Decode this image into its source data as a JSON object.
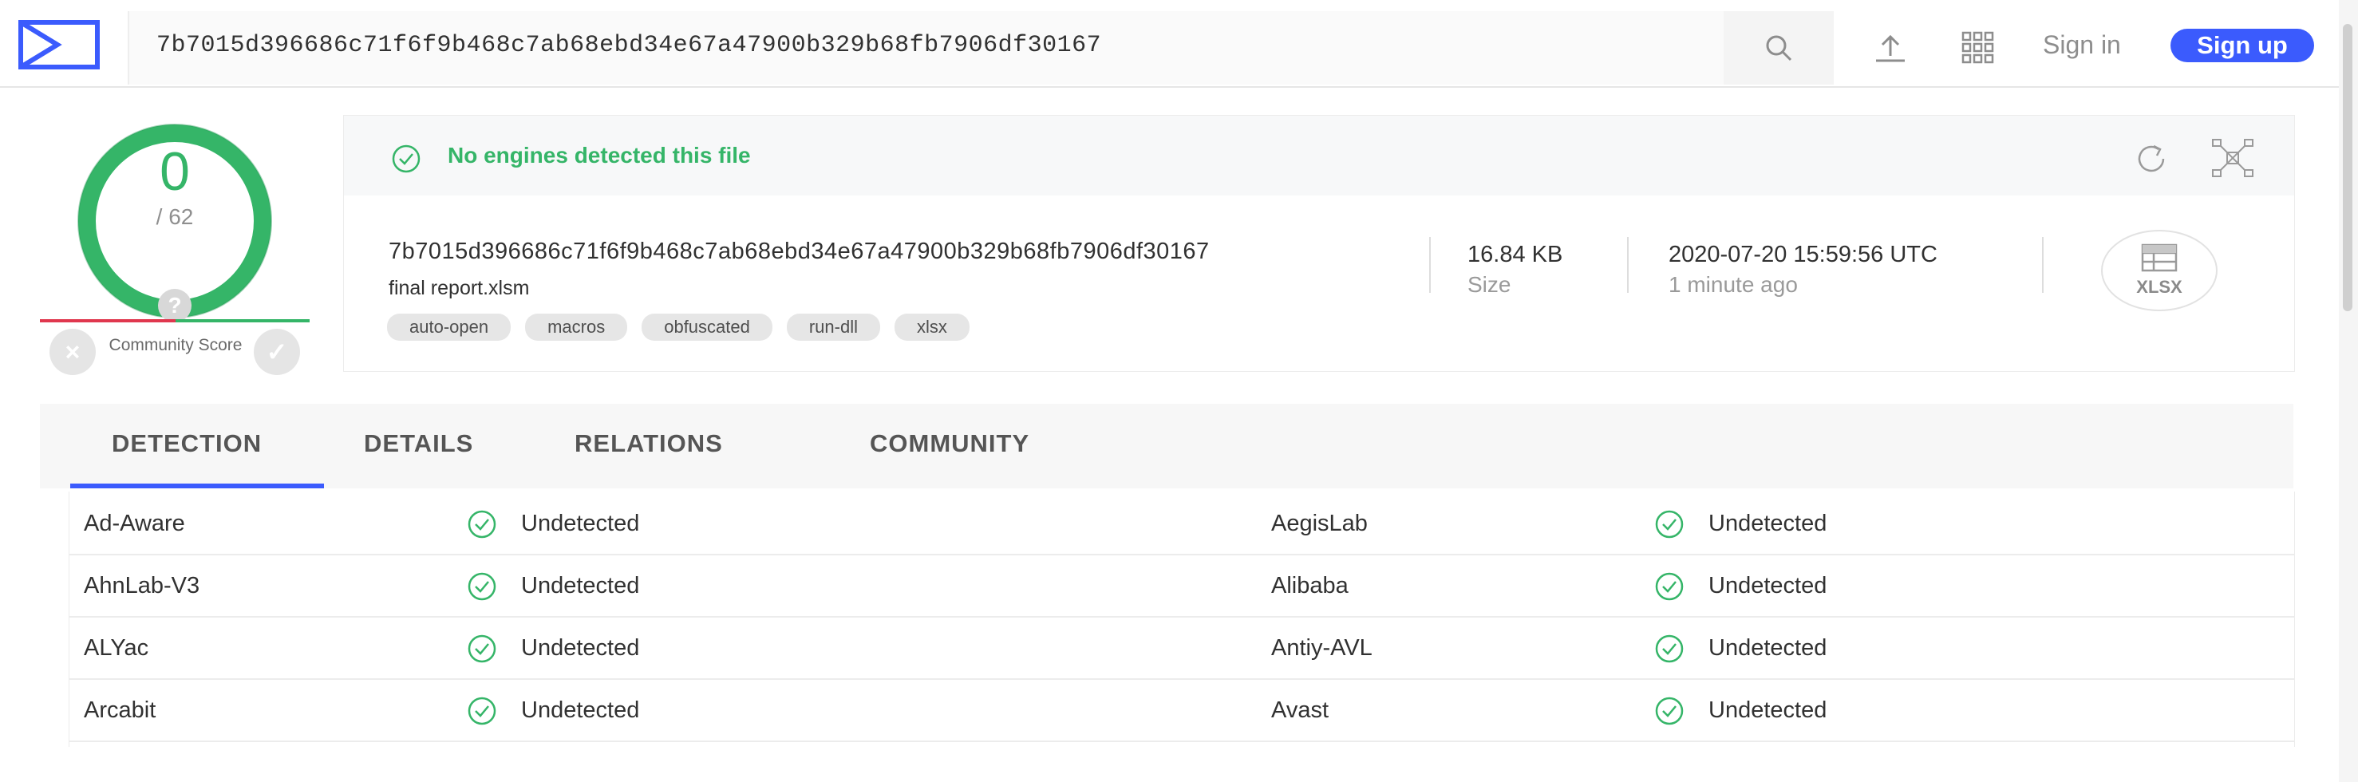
{
  "header": {
    "search_value": "7b7015d396686c71f6f9b468c7ab68ebd34e67a47900b329b68fb7906df30167",
    "sign_in": "Sign in",
    "sign_up": "Sign up",
    "accent_color": "#3b5bfd"
  },
  "score": {
    "detections": "0",
    "total": "/ 62",
    "community_label": "Community Score",
    "community_q": "?"
  },
  "summary": {
    "status_message": "No engines detected this file",
    "hash": "7b7015d396686c71f6f9b468c7ab68ebd34e67a47900b329b68fb7906df30167",
    "filename": "final report.xlsm",
    "tags": [
      "auto-open",
      "macros",
      "obfuscated",
      "run-dll",
      "xlsx"
    ],
    "size_value": "16.84 KB",
    "size_label": "Size",
    "date_value": "2020-07-20 15:59:56 UTC",
    "date_label": "1 minute ago",
    "file_type": "XLSX"
  },
  "tabs": [
    "DETECTION",
    "DETAILS",
    "RELATIONS",
    "COMMUNITY"
  ],
  "results": [
    {
      "left_engine": "Ad-Aware",
      "left_status": "Undetected",
      "right_engine": "AegisLab",
      "right_status": "Undetected"
    },
    {
      "left_engine": "AhnLab-V3",
      "left_status": "Undetected",
      "right_engine": "Alibaba",
      "right_status": "Undetected"
    },
    {
      "left_engine": "ALYac",
      "left_status": "Undetected",
      "right_engine": "Antiy-AVL",
      "right_status": "Undetected"
    },
    {
      "left_engine": "Arcabit",
      "left_status": "Undetected",
      "right_engine": "Avast",
      "right_status": "Undetected"
    }
  ]
}
